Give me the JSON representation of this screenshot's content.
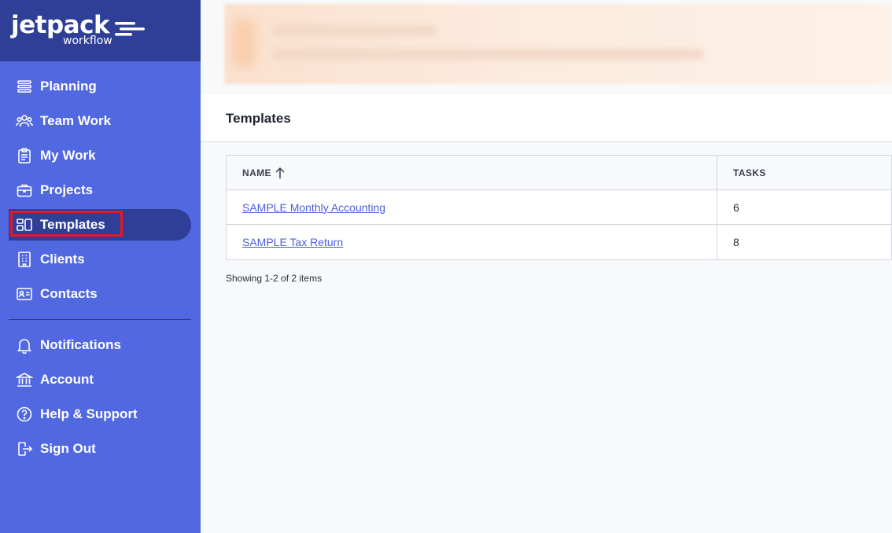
{
  "brand": {
    "name": "jetpack",
    "sub": "workflow"
  },
  "sidebar": {
    "items": [
      {
        "label": "Planning",
        "icon": "list-icon"
      },
      {
        "label": "Team Work",
        "icon": "team-icon"
      },
      {
        "label": "My Work",
        "icon": "clipboard-icon"
      },
      {
        "label": "Projects",
        "icon": "briefcase-icon"
      },
      {
        "label": "Templates",
        "icon": "templates-icon",
        "active": true
      },
      {
        "label": "Clients",
        "icon": "building-icon"
      },
      {
        "label": "Contacts",
        "icon": "contact-card-icon"
      }
    ],
    "bottom_items": [
      {
        "label": "Notifications",
        "icon": "bell-icon"
      },
      {
        "label": "Account",
        "icon": "bank-icon"
      },
      {
        "label": "Help & Support",
        "icon": "help-icon"
      },
      {
        "label": "Sign Out",
        "icon": "sign-out-icon"
      }
    ]
  },
  "main": {
    "title": "Templates",
    "table": {
      "columns": [
        "NAME",
        "TASKS"
      ],
      "rows": [
        {
          "name": "SAMPLE Monthly Accounting",
          "tasks": "6"
        },
        {
          "name": "SAMPLE Tax Return",
          "tasks": "8"
        }
      ]
    },
    "pager": "Showing 1-2 of 2 items"
  },
  "colors": {
    "sidebar": "#5168e0",
    "sidebar_dark": "#2f3f97",
    "link": "#4a5fd6",
    "highlight": "#e8171f"
  }
}
